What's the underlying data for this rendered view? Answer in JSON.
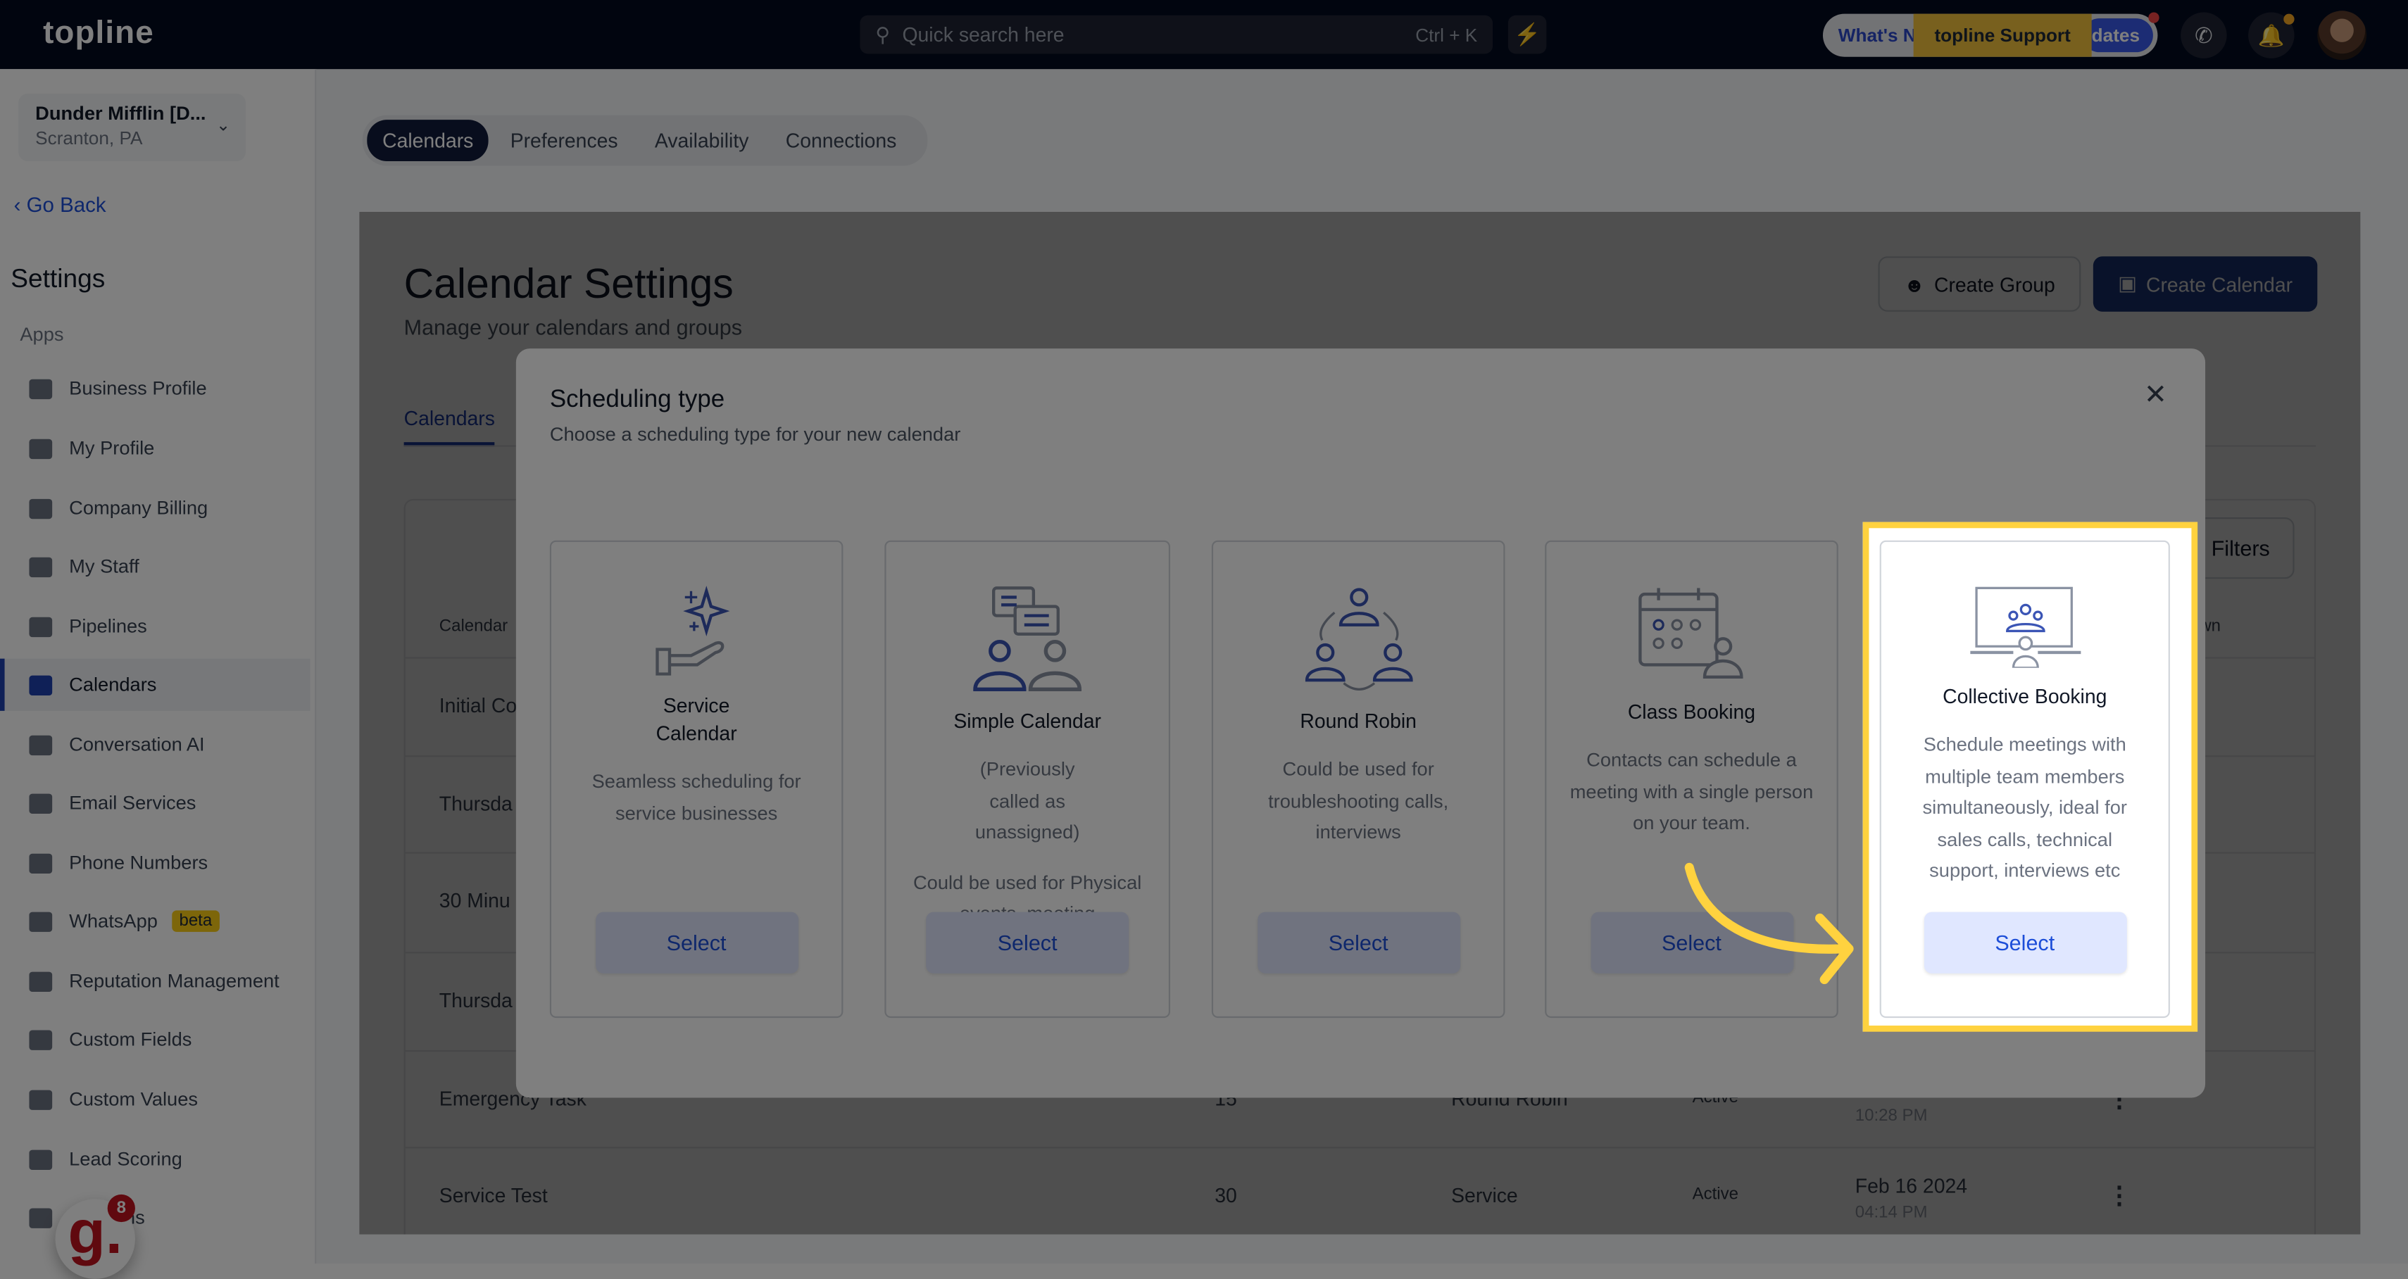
{
  "topbar": {
    "logo": "topline",
    "search_placeholder": "Quick search here",
    "search_shortcut": "Ctrl + K",
    "whats_new": "What's New",
    "updates": "dates",
    "support": "topline Support"
  },
  "sidebar": {
    "location_name": "Dunder Mifflin [D...",
    "location_city": "Scranton, PA",
    "go_back": "Go Back",
    "heading": "Settings",
    "section": "Apps",
    "items": [
      {
        "label": "Business Profile"
      },
      {
        "label": "My Profile"
      },
      {
        "label": "Company Billing"
      },
      {
        "label": "My Staff"
      },
      {
        "label": "Pipelines"
      },
      {
        "label": "Calendars",
        "active": true
      },
      {
        "label": "Conversation AI"
      },
      {
        "label": "Email Services"
      },
      {
        "label": "Phone Numbers"
      },
      {
        "label": "WhatsApp",
        "badge": "beta"
      },
      {
        "label": "Reputation Management"
      },
      {
        "label": "Custom Fields"
      },
      {
        "label": "Custom Values"
      },
      {
        "label": "Lead Scoring"
      },
      {
        "label": "Domains"
      }
    ],
    "widget_letter": "g.",
    "widget_badge": "8"
  },
  "top_tabs": [
    "Calendars",
    "Preferences",
    "Availability",
    "Connections"
  ],
  "page": {
    "title": "Calendar Settings",
    "subtitle": "Manage your calendars and groups",
    "create_group": "Create Group",
    "create_calendar": "Create Calendar",
    "subtab": "Calendars",
    "filters": "Filters",
    "table": {
      "header_first": "Calendar",
      "header_last": "wn",
      "rows": [
        {
          "name": "Initial Co"
        },
        {
          "name": "Thursda"
        },
        {
          "name": "30 Minu"
        },
        {
          "name": "Thursda"
        },
        {
          "name": "Emergency Task",
          "duration": "15",
          "type": "Round Robin",
          "status": "Active",
          "date": "",
          "time": "10:28 PM"
        },
        {
          "name": "Service Test",
          "duration": "30",
          "type": "Service",
          "status": "Active",
          "date": "Feb 16 2024",
          "time": "04:14 PM"
        }
      ]
    }
  },
  "modal": {
    "title": "Scheduling type",
    "subtitle": "Choose a scheduling type for your new calendar",
    "cards": [
      {
        "title": "Service Calendar",
        "desc": "Seamless scheduling for service businesses",
        "select": "Select",
        "icon": "hand-sparkle-icon"
      },
      {
        "title": "Simple Calendar",
        "desc": "(Previously called as unassigned)",
        "desc2": "Could be used for Physical events, meeting",
        "select": "Select",
        "icon": "people-chat-icon"
      },
      {
        "title": "Round Robin",
        "desc": "Could be used for troubleshooting calls, interviews",
        "select": "Select",
        "icon": "round-robin-icon"
      },
      {
        "title": "Class Booking",
        "desc": "Contacts can schedule a meeting with a single person on your team.",
        "select": "Select",
        "icon": "calendar-group-icon"
      },
      {
        "title": "Collective Booking",
        "desc": "Schedule meetings with multiple team members simultaneously, ideal for sales calls, technical support, interviews etc",
        "select": "Select",
        "icon": "presentation-icon",
        "highlighted": true
      }
    ]
  },
  "colors": {
    "navy": "#020a1f",
    "accent": "#1e40af",
    "highlight": "#ffd23f"
  }
}
